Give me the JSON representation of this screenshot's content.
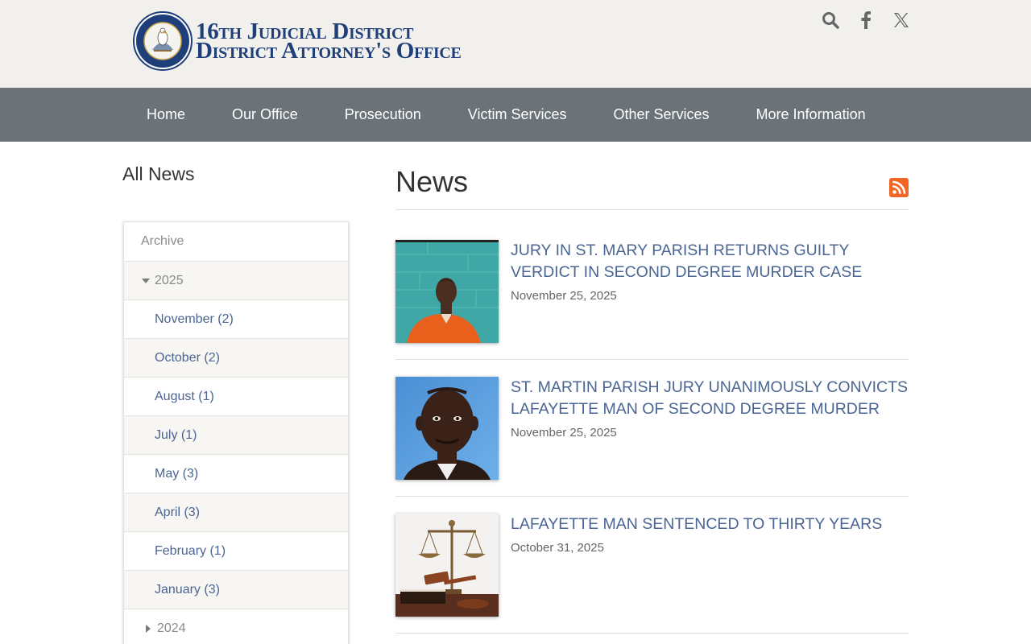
{
  "header": {
    "logo_line1": "16th Judicial District",
    "logo_line2": "District Attorney's Office",
    "seal_text": "STATE OF LOUISIANA",
    "icons": [
      "search-icon",
      "facebook-icon",
      "x-icon"
    ]
  },
  "nav": {
    "items": [
      "Home",
      "Our Office",
      "Prosecution",
      "Victim Services",
      "Other Services",
      "More Information"
    ]
  },
  "sidebar": {
    "title": "All News",
    "archive_label": "Archive",
    "year_open": "2025",
    "months": [
      "November (2)",
      "October (2)",
      "August (1)",
      "July (1)",
      "May (3)",
      "April (3)",
      "February (1)",
      "January (3)"
    ],
    "year_closed": "2024"
  },
  "main": {
    "title": "News",
    "rss_icon": "rss-icon",
    "articles": [
      {
        "headline": "JURY IN ST. MARY PARISH RETURNS GUILTY VERDICT IN SECOND DEGREE MURDER CASE",
        "date": "November 25, 2025"
      },
      {
        "headline": "ST. MARTIN PARISH JURY UNANIMOUSLY CONVICTS LAFAYETTE MAN OF SECOND DEGREE MURDER",
        "date": "November 25, 2025"
      },
      {
        "headline": "LAFAYETTE MAN SENTENCED TO THIRTY YEARS",
        "date": "October 31, 2025"
      }
    ]
  },
  "colors": {
    "header_bg": "#f2f0ed",
    "nav_bg": "#6b7378",
    "link": "#4a6593",
    "logo": "#1f3f7a",
    "rss": "#f26522"
  }
}
